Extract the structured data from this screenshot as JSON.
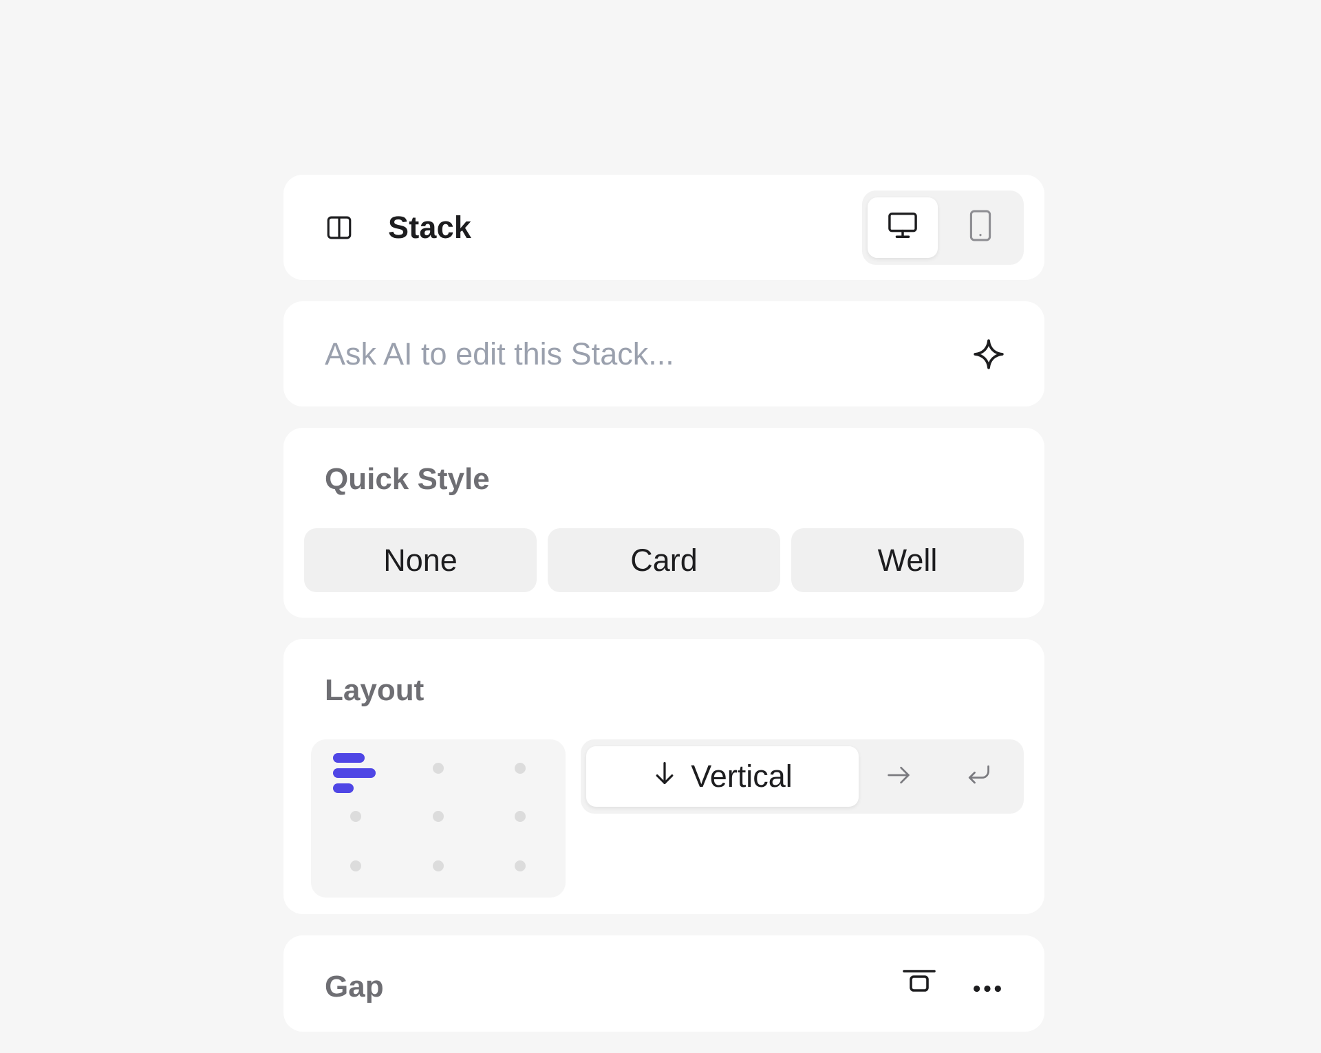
{
  "header": {
    "title": "Stack",
    "layout_icon": "columns-layout-icon",
    "devices": [
      {
        "name": "desktop",
        "icon": "monitor-icon",
        "active": true
      },
      {
        "name": "mobile",
        "icon": "phone-icon",
        "active": false
      }
    ]
  },
  "ai": {
    "placeholder": "Ask AI to edit this Stack...",
    "value": "",
    "icon": "sparkle-icon"
  },
  "quick_style": {
    "title": "Quick Style",
    "options": [
      "None",
      "Card",
      "Well"
    ]
  },
  "layout": {
    "title": "Layout",
    "alignment_selected": "top-left",
    "direction": {
      "active_label": "Vertical",
      "options": [
        "vertical",
        "horizontal",
        "wrap"
      ]
    }
  },
  "gap": {
    "title": "Gap"
  },
  "colors": {
    "background": "#f6f6f6",
    "card": "#ffffff",
    "accent": "#4f46e5",
    "muted_text": "#6e6e73",
    "placeholder": "#9aa0ad"
  }
}
